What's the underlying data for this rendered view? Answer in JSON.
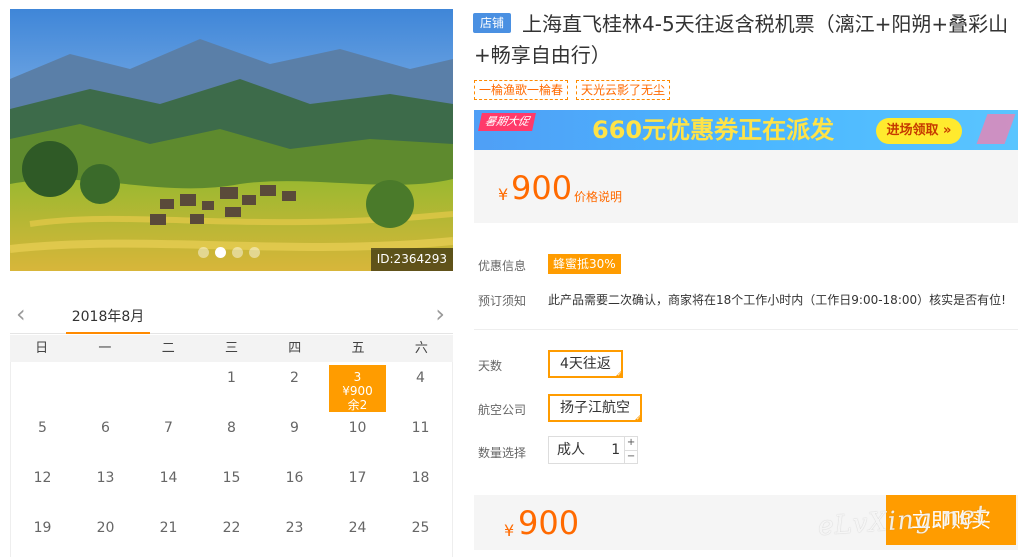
{
  "photo": {
    "id_label": "ID:2364293",
    "slides": 4,
    "active_slide": 2
  },
  "calendar": {
    "month": "2018年8月",
    "weekdays": [
      "日",
      "一",
      "二",
      "三",
      "四",
      "五",
      "六"
    ],
    "weeks": [
      [
        "",
        "",
        "",
        "1",
        "2",
        "3",
        "4"
      ],
      [
        "5",
        "6",
        "7",
        "8",
        "9",
        "10",
        "11"
      ],
      [
        "12",
        "13",
        "14",
        "15",
        "16",
        "17",
        "18"
      ],
      [
        "19",
        "20",
        "21",
        "22",
        "23",
        "24",
        "25"
      ]
    ],
    "available": {
      "day": "3",
      "price": "¥900",
      "remaining": "余2"
    }
  },
  "product": {
    "shop_tag": "店铺",
    "title": "上海直飞桂林4-5天往返含税机票（漓江+阳朔+叠彩山+畅享自由行）",
    "tags": [
      "一棆渔歌一棆春",
      "天光云影了无尘"
    ]
  },
  "banner": {
    "badge": "暑期大促",
    "headline": "660元优惠券正在派发",
    "button": "进场领取 »"
  },
  "price": {
    "currency": "¥",
    "amount": "900",
    "link": "价格说明"
  },
  "info": {
    "discount_label": "优惠信息",
    "discount_value": "蜂蜜抵30%",
    "notice_label": "预订须知",
    "notice_text": "此产品需要二次确认，商家将在18个工作小时内（工作日9:00-18:00）核实是否有位!"
  },
  "options": {
    "days_label": "天数",
    "days_value": "4天往返",
    "airline_label": "航空公司",
    "airline_value": "扬子江航空",
    "qty_label": "数量选择",
    "qty_type": "成人",
    "qty_value": "1",
    "plus": "+",
    "minus": "−"
  },
  "total": {
    "currency": "¥",
    "amount": "900",
    "buy_label": "立即购买"
  },
  "watermark": "eLvXing.net",
  "colors": {
    "accent": "#ff9c00",
    "price": "#ff6a00",
    "shop_tag": "#4a90e2"
  }
}
